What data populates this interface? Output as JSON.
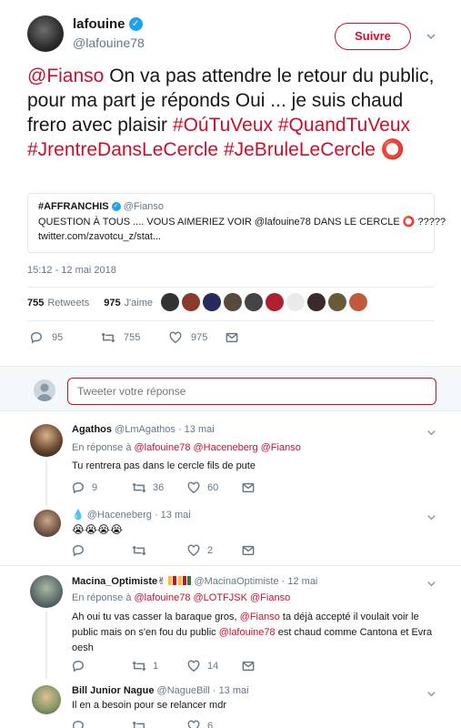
{
  "tweet": {
    "author_name": "lafouine",
    "author_handle": "@lafouine78",
    "follow_label": "Suivre",
    "text_parts": [
      {
        "t": "@Fianso",
        "red": true
      },
      {
        "t": " On va pas attendre le retour du public, pour ma part je réponds Oui ... je suis chaud frero avec plaisir ",
        "red": false
      },
      {
        "t": "#OúTuVeux",
        "red": true
      },
      {
        "t": " ",
        "red": false
      },
      {
        "t": "#QuandTuVeux",
        "red": true
      },
      {
        "t": " ",
        "red": false
      },
      {
        "t": "#JrentreDansLeCercle",
        "red": true
      },
      {
        "t": " ",
        "red": false
      },
      {
        "t": "#JeBruleLeCercle",
        "red": true
      },
      {
        "t": " ⭕",
        "red": true
      }
    ],
    "quote": {
      "name": "#AFFRANCHIS",
      "handle": "@Fianso",
      "line1": "QUESTION À TOUS .... VOUS AIMERIEZ VOIR @lafouine78 DANS LE CERCLE ⭕ ?????",
      "line2": "twitter.com/zavotcu_z/stat..."
    },
    "timestamp": "15:12 - 12 mai 2018",
    "retweets_count": "755",
    "retweets_label": "Retweets",
    "likes_count": "975",
    "likes_label": "J'aime",
    "actions": {
      "replies": "95",
      "retweets": "755",
      "likes": "975"
    }
  },
  "reply_box": {
    "placeholder": "Tweeter votre réponse"
  },
  "replies": [
    {
      "name": "Agathos",
      "handle": "@LmAgathos",
      "date": "· 13 mai",
      "reply_to_prefix": "En réponse à",
      "reply_to": "@lafouine78 @Haceneberg @Fianso",
      "text": "Tu rentrera pas dans le cercle fils de pute",
      "counts": {
        "replies": "9",
        "retweets": "36",
        "likes": "60"
      }
    },
    {
      "name": "💧",
      "handle": "@Haceneberg",
      "date": "· 13 mai",
      "text": "😭😭😭😭",
      "counts": {
        "replies": "",
        "retweets": "",
        "likes": "2"
      }
    },
    {
      "name": "Macina_Optimiste✌",
      "handle": "@MacinaOptimiste",
      "date": "· 12 mai",
      "reply_to_prefix": "En réponse à",
      "reply_to": "@lafouine78 @LOTFJSK @Fianso",
      "text_a": "Ah oui tu vas casser la baraque gros, ",
      "text_mention": "@Fianso",
      "text_b": "  ta déjà accepté il voulait voir le public mais on s'en fou du public ",
      "text_mention2": "@lafouine78",
      "text_c": " est chaud comme Cantona et Evra oesh",
      "counts": {
        "replies": "",
        "retweets": "1",
        "likes": "14"
      }
    },
    {
      "name": "Bill Junior Nague",
      "handle": "@NagueBill",
      "date": "· 13 mai",
      "text": "Il en a besoin pour se relancer mdr",
      "counts": {
        "replies": "",
        "retweets": "",
        "likes": "6"
      }
    }
  ],
  "colors": {
    "accent": "#c8102e",
    "verified": "#1da1f2",
    "muted": "#657786"
  }
}
